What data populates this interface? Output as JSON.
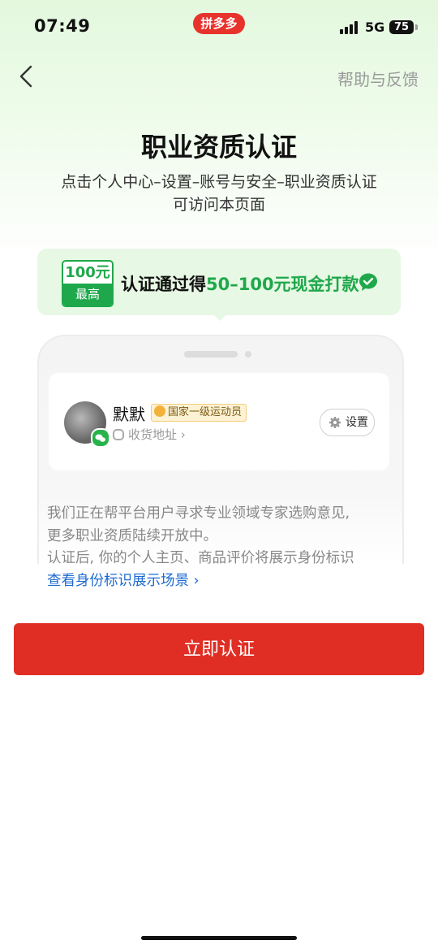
{
  "status_bar": {
    "time": "07:49",
    "app_badge": "拼多多",
    "network": "5G",
    "battery": "75"
  },
  "nav": {
    "back_icon": "chevron-left-icon",
    "help_label": "帮助与反馈"
  },
  "header": {
    "title": "职业资质认证",
    "subtitle_line1": "点击个人中心–设置–账号与安全–职业资质认证",
    "subtitle_line2": "可访问本页面"
  },
  "reward": {
    "badge_amount": "100元",
    "badge_label": "最高",
    "text_prefix": "认证通过得",
    "text_amount": "50–100元现金打款",
    "icon": "wechat-check-icon",
    "accent_color": "#1fa84b"
  },
  "preview": {
    "username": "默默",
    "tag": "国家一级运动员",
    "address_label": "收货地址",
    "address_chevron": "›",
    "settings_label": "设置"
  },
  "info": {
    "line1": "我们正在帮平台用户寻求专业领域专家选购意见,",
    "line2": "更多职业资质陆续开放中。",
    "line3": "认证后, 你的个人主页、商品评价将展示身份标识",
    "link": "查看身份标识展示场景 ›",
    "link_color": "#1d6bd1"
  },
  "cta": {
    "label": "立即认证",
    "color": "#e02e24"
  }
}
